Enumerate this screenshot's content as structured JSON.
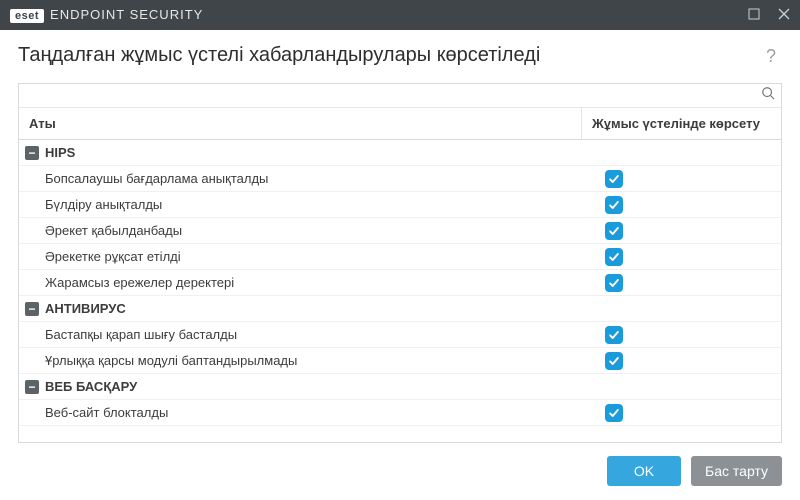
{
  "titlebar": {
    "brand_short": "eset",
    "brand_product": "ENDPOINT SECURITY"
  },
  "header": {
    "title": "Таңдалған жұмыс үстелі хабарландырулары көрсетіледі",
    "help_symbol": "?"
  },
  "table": {
    "col_name": "Аты",
    "col_show": "Жұмыс үстелінде көрсету"
  },
  "groups": [
    {
      "name": "HIPS",
      "expanded": true,
      "items": [
        {
          "label": "Бопсалаушы бағдарлама анықталды",
          "checked": true
        },
        {
          "label": "Бүлдіру анықталды",
          "checked": true
        },
        {
          "label": "Әрекет қабылданбады",
          "checked": true
        },
        {
          "label": "Әрекетке рұқсат етілді",
          "checked": true
        },
        {
          "label": "Жарамсыз ережелер деректері",
          "checked": true
        }
      ]
    },
    {
      "name": "АНТИВИРУС",
      "expanded": true,
      "items": [
        {
          "label": "Бастапқы қарап шығу басталды",
          "checked": true
        },
        {
          "label": "Ұрлыққа қарсы модулі баптандырылмады",
          "checked": true
        }
      ]
    },
    {
      "name": "ВЕБ БАСҚАРУ",
      "expanded": true,
      "items": [
        {
          "label": "Веб-сайт блокталды",
          "checked": true
        }
      ]
    }
  ],
  "footer": {
    "ok": "OK",
    "cancel": "Бас тарту"
  }
}
